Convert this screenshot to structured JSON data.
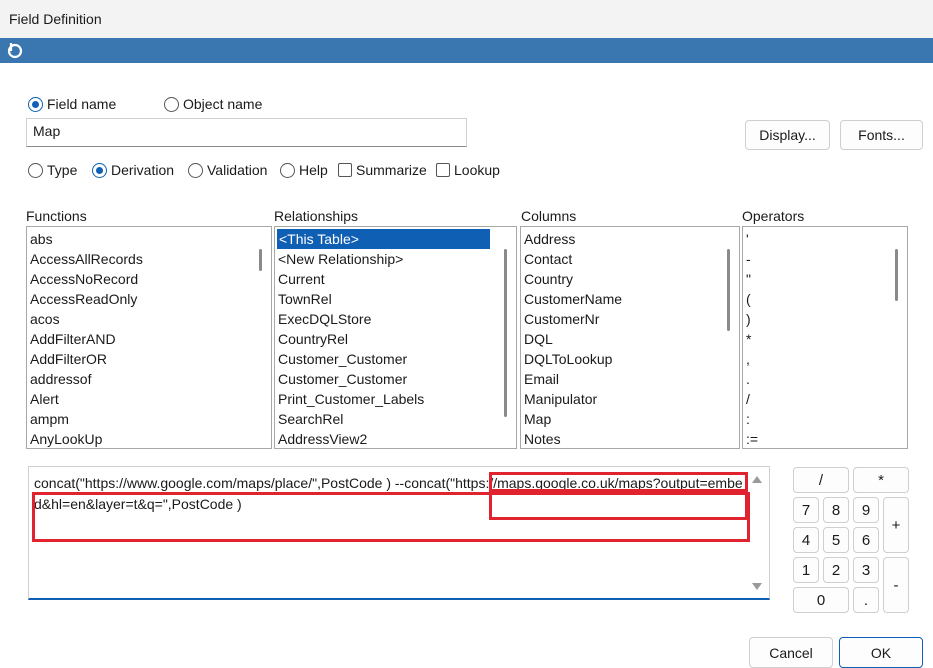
{
  "window": {
    "title": "Field Definition"
  },
  "colors": {
    "accent": "#0f5fb5",
    "bluebar": "#3a77b0",
    "highlight": "#e0232f"
  },
  "name_mode": {
    "field_name_label": "Field name",
    "object_name_label": "Object name",
    "selected": "field_name"
  },
  "name_input": {
    "value": "Map"
  },
  "buttons": {
    "display": "Display...",
    "fonts": "Fonts...",
    "cancel": "Cancel",
    "ok": "OK"
  },
  "mode_tabs": [
    {
      "label": "Type",
      "kind": "radio",
      "checked": false
    },
    {
      "label": "Derivation",
      "kind": "radio",
      "checked": true
    },
    {
      "label": "Validation",
      "kind": "radio",
      "checked": false
    },
    {
      "label": "Help",
      "kind": "radio",
      "checked": false
    },
    {
      "label": "Summarize",
      "kind": "checkbox",
      "checked": false
    },
    {
      "label": "Lookup",
      "kind": "checkbox",
      "checked": false
    }
  ],
  "lists": {
    "functions": {
      "label": "Functions",
      "items": [
        "abs",
        "AccessAllRecords",
        "AccessNoRecord",
        "AccessReadOnly",
        "acos",
        "AddFilterAND",
        "AddFilterOR",
        "addressof",
        "Alert",
        "ampm",
        "AnyLookUp"
      ]
    },
    "relationships": {
      "label": "Relationships",
      "items": [
        "<This Table>",
        "<New Relationship>",
        "Current",
        "TownRel",
        "ExecDQLStore",
        "CountryRel",
        "Customer_Customer",
        "Customer_Customer",
        "Print_Customer_Labels",
        "SearchRel",
        "AddressView2"
      ],
      "selected_index": 0
    },
    "columns": {
      "label": "Columns",
      "items": [
        "Address",
        "Contact",
        "Country",
        "CustomerName",
        "CustomerNr",
        "DQL",
        "DQLToLookup",
        "Email",
        "Manipulator",
        "Map",
        "Notes"
      ]
    },
    "operators": {
      "label": "Operators",
      "items": [
        "'",
        "-",
        "\"",
        "(",
        ")",
        "*",
        ",",
        ".",
        "/",
        ":",
        ":="
      ]
    }
  },
  "expression": {
    "text": "concat(\"https://www.google.com/maps/place/\",PostCode ) --concat(\"https://maps.google.co.uk/maps?output=embed&hl=en&layer=t&q=\",PostCode )"
  },
  "keypad": {
    "slash": "/",
    "star": "*",
    "plus": "+",
    "minus": "-",
    "digits": [
      "7",
      "8",
      "9",
      "4",
      "5",
      "6",
      "1",
      "2",
      "3"
    ],
    "zero": "0",
    "dot": "."
  }
}
